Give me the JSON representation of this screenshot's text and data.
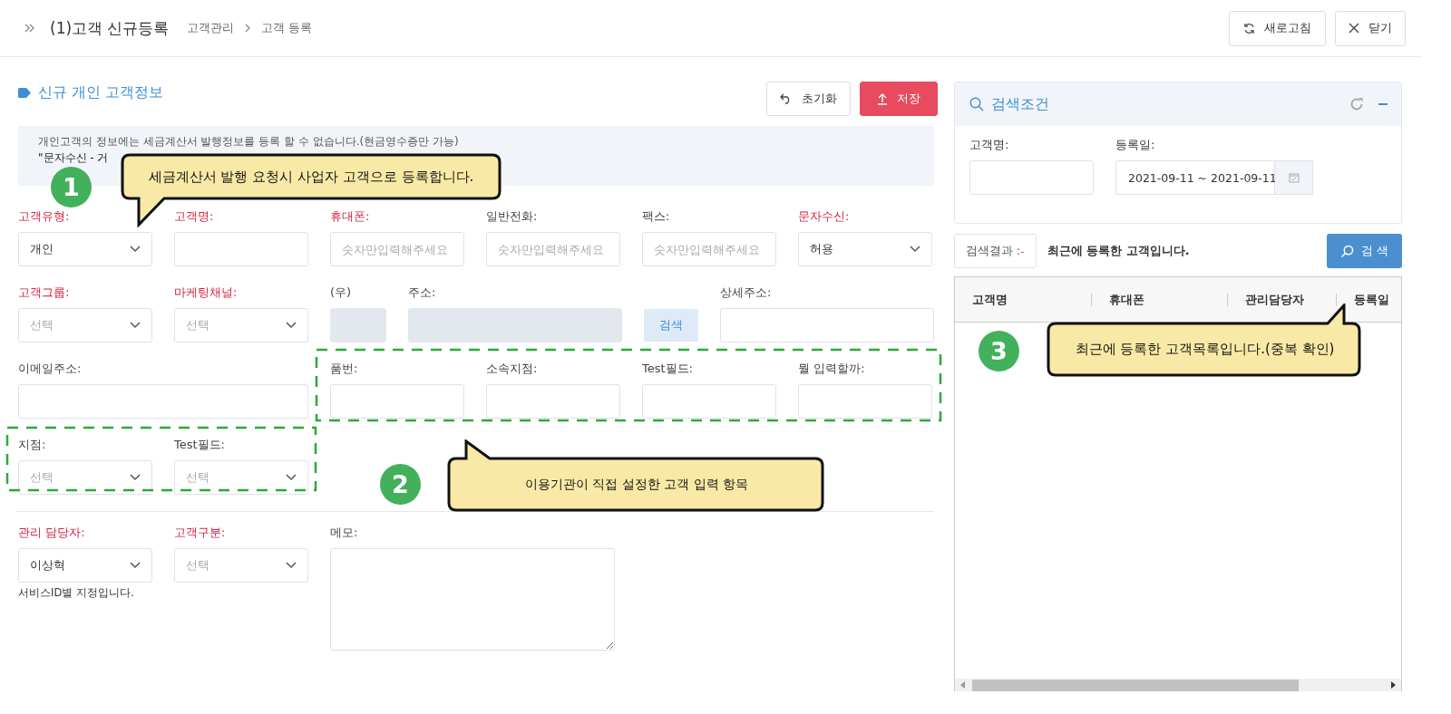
{
  "header": {
    "title": "(1)고객 신규등록",
    "breadcrumb": [
      "고객관리",
      "고객 등록"
    ],
    "buttons": [
      {
        "label": "새로고침",
        "kind": "refresh"
      },
      {
        "label": "닫기",
        "kind": "close"
      }
    ]
  },
  "form": {
    "title": "신규 개인 고객정보",
    "actions": [
      {
        "label": "초기화",
        "kind": "reset"
      },
      {
        "label": "저장",
        "kind": "save"
      }
    ],
    "notice": [
      "개인고객의 정보에는 세금계산서 발행정보를 등록 할 수 없습니다.(현금영수증만 가능)",
      "\"문자수신 - 거"
    ],
    "rows": [
      {
        "fields": [
          {
            "label": "고객유형:",
            "required": true,
            "kind": "select",
            "value": "개인"
          },
          {
            "label": "고객명:",
            "required": true,
            "kind": "input"
          },
          {
            "label": "휴대폰:",
            "required": true,
            "kind": "input",
            "placeholder": "숫자만입력해주세요"
          },
          {
            "label": "일반전화:",
            "required": false,
            "kind": "input",
            "placeholder": "숫자만입력해주세요"
          },
          {
            "label": "팩스:",
            "required": false,
            "kind": "input",
            "placeholder": "숫자만입력해주세요"
          },
          {
            "label": "문자수신:",
            "required": true,
            "kind": "select",
            "value": "허용"
          }
        ]
      },
      {
        "fields": [
          {
            "label": "고객그룹:",
            "required": true,
            "kind": "select",
            "placeholder": "선택"
          },
          {
            "label": "마케팅채널:",
            "required": true,
            "kind": "select",
            "placeholder": "선택"
          },
          {
            "label": "(우)",
            "required": false,
            "kind": "zip",
            "readonly": true
          },
          {
            "label": "주소:",
            "required": false,
            "kind": "address",
            "readonly": true
          },
          {
            "kind": "button",
            "text": "검색"
          },
          {
            "label": "상세주소:",
            "required": false,
            "kind": "address",
            "readonly": false
          }
        ]
      },
      {
        "fields": [
          {
            "label": "이메일주소:",
            "required": false,
            "kind": "wide"
          },
          {
            "label": "품번:",
            "required": false,
            "kind": "input"
          },
          {
            "label": "소속지점:",
            "required": false,
            "kind": "input"
          },
          {
            "label": "Test필드:",
            "required": false,
            "kind": "input"
          },
          {
            "label": "뭘 입력할까:",
            "required": false,
            "kind": "input"
          }
        ]
      },
      {
        "fields": [
          {
            "label": "지점:",
            "required": false,
            "kind": "select",
            "placeholder": "선택"
          },
          {
            "label": "Test필드:",
            "required": false,
            "kind": "select",
            "placeholder": "선택"
          }
        ]
      }
    ],
    "bottom_row": [
      {
        "label": "관리 담당자:",
        "required": true,
        "kind": "select",
        "value": "이상혁",
        "help": "서비스ID별 지정입니다."
      },
      {
        "label": "고객구분:",
        "required": true,
        "kind": "select",
        "placeholder": "선택"
      },
      {
        "label": "메모:",
        "required": false,
        "kind": "textarea"
      }
    ]
  },
  "search": {
    "title": "검색조건",
    "fields": [
      {
        "label": "고객명:",
        "kind": "input"
      },
      {
        "label": "등록일:",
        "kind": "date",
        "value": "2021-09-11 ~ 2021-09-11"
      }
    ],
    "result_label": "검색결과 :",
    "result_count": "-",
    "result_note": "최근에 등록한 고객입니다.",
    "search_button": "검 색",
    "columns": [
      "고객명",
      "휴대폰",
      "관리담당자",
      "등록일"
    ]
  },
  "callouts": [
    {
      "number": "1",
      "text": "세금계산서 발행 요청시 사업자 고객으로 등록합니다."
    },
    {
      "number": "2",
      "text": "이용기관이 직접 설정한 고객 입력 항목"
    },
    {
      "number": "3",
      "text": "최근에 등록한 고객목록입니다.(중복 확인)"
    }
  ]
}
